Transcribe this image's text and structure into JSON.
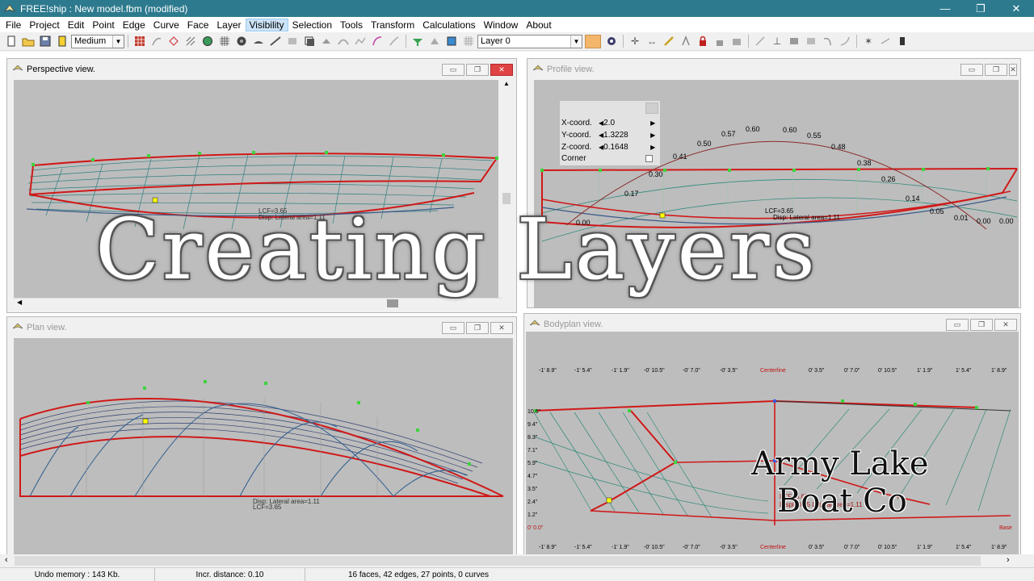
{
  "app": {
    "name": "FREE!ship",
    "title": "FREE!ship   : New model.fbm (modified)",
    "controls": [
      "—",
      "❐",
      "✕"
    ]
  },
  "menu": [
    "File",
    "Project",
    "Edit",
    "Point",
    "Edge",
    "Curve",
    "Face",
    "Layer",
    "Visibility",
    "Selection",
    "Tools",
    "Transform",
    "Calculations",
    "Window",
    "About"
  ],
  "menu_active": "Visibility",
  "toolbar": {
    "precision": "Medium",
    "layer": "Layer 0",
    "layer_color": "#f4b66a"
  },
  "views": {
    "perspective": {
      "title": "Perspective view.",
      "lcf": "LCF=3.65",
      "disp": "Disp: Lateral area=1.11"
    },
    "profile": {
      "title": "Profile view.",
      "coords": {
        "x_label": "X-coord.",
        "x_value": "2.0",
        "y_label": "Y-coord.",
        "y_value": "1.3228",
        "z_label": "Z-coord.",
        "z_value": "0.1648",
        "corner": "Corner"
      },
      "curve_labels": [
        "0.00",
        "0.17",
        "0.30",
        "0.41",
        "0.50",
        "0.57",
        "0.60",
        "0.60",
        "0.55",
        "0.48",
        "0.38",
        "0.26",
        "0.14",
        "0.05",
        "0.01",
        "0.00",
        "0.00",
        "0.00"
      ],
      "lcf": "LCF=3.65",
      "disp": "Disp: Lateral area=1.11"
    },
    "plan": {
      "title": "Plan view.",
      "lcf": "LCF=3.65",
      "disp": "Disp: Lateral area=1.11"
    },
    "bodyplan": {
      "title": "Bodyplan view.",
      "top_ticks": [
        "-1' 8.9\"",
        "-1' 5.4\"",
        "-1' 1.9\"",
        "-0' 10.5\"",
        "-0' 7.0\"",
        "-0' 3.5\"",
        "Centerline",
        "0' 3.5\"",
        "0' 7.0\"",
        "0' 10.5\"",
        "1' 1.9\"",
        "1' 5.4\"",
        "1' 8.9\""
      ],
      "bottom_ticks": [
        "-1' 8.9\"",
        "-1' 5.4\"",
        "-1' 1.9\"",
        "-0' 10.5\"",
        "-0' 7.0\"",
        "-0' 3.5\"",
        "Centerline",
        "0' 3.5\"",
        "0' 7.0\"",
        "0' 10.5\"",
        "1' 1.9\"",
        "1' 5.4\"",
        "1' 8.9\""
      ],
      "left_ticks": [
        "10.6\"",
        "9.4\"",
        "8.3\"",
        "7.1\"",
        "5.9\"",
        "4.7\"",
        "3.5\"",
        "2.4\"",
        "1.2\"",
        "0' 0.0\""
      ],
      "base": "Base",
      "lcf": "LCF=3.65",
      "disp": "Displ=0.05 Lateral area=1.11"
    }
  },
  "overlay": {
    "title": "Creating Layers",
    "brand_line1": "Army Lake",
    "brand_line2": "Boat Co"
  },
  "status": {
    "undo": "Undo memory : 143 Kb.",
    "incr": "Incr. distance: 0.10",
    "counts": "16 faces, 42 edges, 27 points, 0 curves"
  }
}
